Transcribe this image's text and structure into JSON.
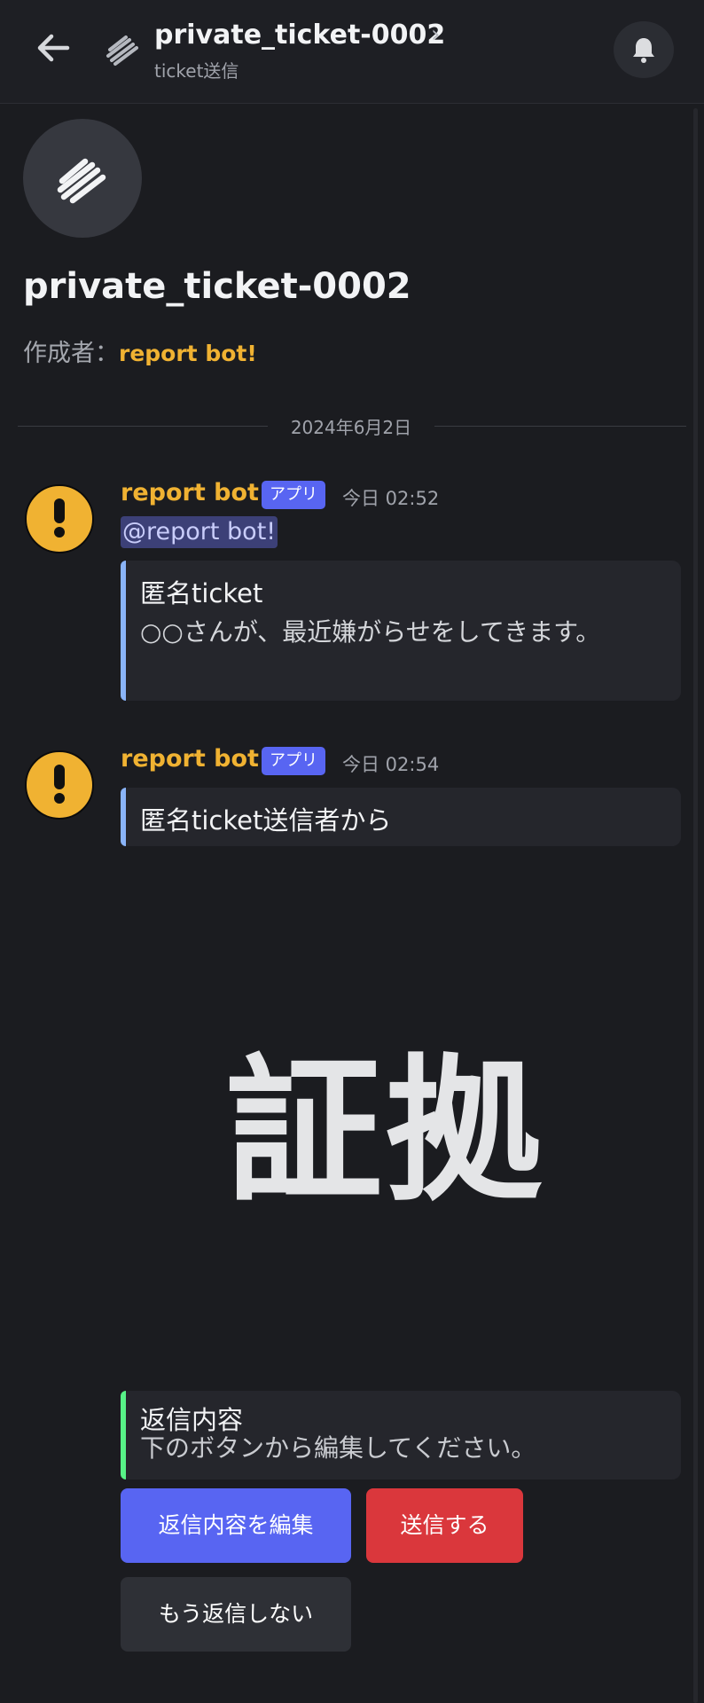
{
  "header": {
    "title": "private_ticket-0002",
    "chevron": "›",
    "subtitle": "ticket送信",
    "icons": {
      "back": "arrow-left-icon",
      "thread": "thread-icon",
      "bell": "bell-icon"
    }
  },
  "channel_intro": {
    "title": "private_ticket-0002",
    "creator_label": "作成者：",
    "creator_name": "report bot!"
  },
  "date_divider": "2024年6月2日",
  "messages": [
    {
      "author": "report bot!",
      "badge": "アプリ",
      "time": "今日 02:52",
      "mention": "@report bot!",
      "embed": {
        "title": "匿名ticket",
        "description": "○○さんが、最近嫌がらせをしてきます。",
        "accent": "#8ab4f8"
      }
    },
    {
      "author": "report bot!",
      "badge": "アプリ",
      "time": "今日 02:54",
      "embed": {
        "title": "匿名ticket送信者から",
        "accent": "#8ab4f8"
      },
      "image_text": "証拠",
      "reply_embed": {
        "title": "返信内容",
        "description": "下のボタンから編集してください。",
        "accent": "#57f287"
      },
      "buttons": {
        "edit": "返信内容を編集",
        "send": "送信する",
        "no_reply": "もう返信しない"
      }
    }
  ],
  "colors": {
    "background": "#1b1c20",
    "username": "#f0b232",
    "blurple": "#5865f2",
    "danger": "#da373c",
    "secondary": "#2e3036"
  }
}
